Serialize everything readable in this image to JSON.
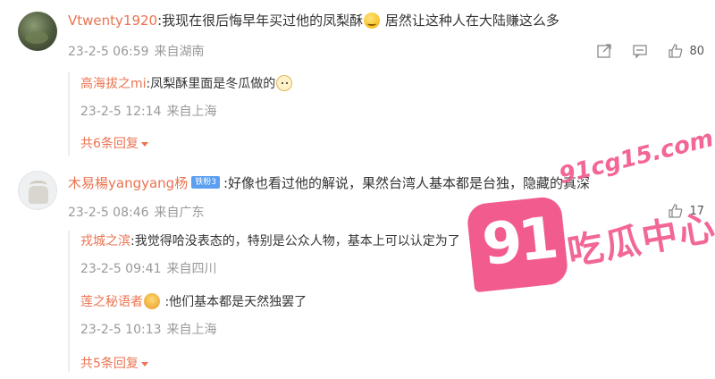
{
  "comment1": {
    "username": "Vtwenty1920",
    "text_before_emoji": ":我现在很后悔早年买过他的凤梨酥",
    "text_after_emoji": " 居然让这种人在大陆赚这么多",
    "emoji": "awkward-smile-emoji",
    "time": "23-2-5 06:59",
    "location": "来自湖南",
    "likes": "80",
    "replies": [
      {
        "username": "高海拔之mi",
        "text": ":凤梨酥里面是冬瓜做的",
        "emoji": "cat-face-emoji",
        "time": "23-2-5 12:14",
        "location": "来自上海"
      }
    ],
    "more_replies": "共6条回复"
  },
  "comment2": {
    "username": "木易楊yangyang杨",
    "badge": "铁粉3",
    "text": ":好像也看过他的解说，果然台湾人基本都是台独，隐藏的真深",
    "time": "23-2-5 08:46",
    "location": "来自广东",
    "likes": "17",
    "replies": [
      {
        "username": "戎城之滨",
        "text": ":我觉得哈没表态的，特别是公众人物，基本上可以认定为了",
        "time": "23-2-5 09:41",
        "location": "来自四川"
      },
      {
        "username": "莲之秘语者",
        "text": " :他们基本都是天然独罢了",
        "emoji": "crown-emoji",
        "time": "23-2-5 10:13",
        "location": "来自上海"
      }
    ],
    "more_replies": "共5条回复"
  },
  "watermark": {
    "badge": "91",
    "url": "91cg15.com",
    "text": "吃瓜中心"
  },
  "colors": {
    "username": "#eb7350",
    "meta": "#999999",
    "watermark": "#f15b8d"
  }
}
